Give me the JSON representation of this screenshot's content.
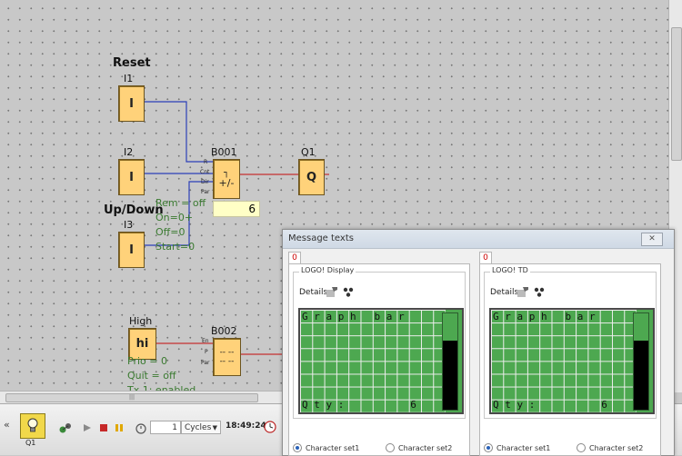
{
  "canvas": {
    "reset_label": "Reset",
    "updown_label": "Up/Down",
    "high_label": "High",
    "blocks": {
      "i1": {
        "name": "I1",
        "symbol": "I"
      },
      "i2": {
        "name": "I2",
        "symbol": "I"
      },
      "i3": {
        "name": "I3",
        "symbol": "I"
      },
      "b001": {
        "name": "B001",
        "symbol": "+/-",
        "pins": [
          "R",
          "Cnt",
          "Dir",
          "Par"
        ],
        "value": "6"
      },
      "q1": {
        "name": "Q1",
        "symbol": "Q"
      },
      "hi": {
        "symbol": "hi"
      },
      "b002": {
        "name": "B002",
        "pins": [
          "En",
          "P",
          "Par"
        ],
        "symbol": "-- --"
      }
    },
    "b001_params": [
      "Rem = off",
      "On=0+",
      "Off=0",
      "Start=0"
    ],
    "b002_params": [
      "Prio = 0",
      "Quit = off",
      "Tx 1: enabled"
    ]
  },
  "message_window": {
    "title": "Message texts",
    "close_label": "✕",
    "panels": [
      {
        "tab": "0",
        "caption": "LOGO! Display",
        "details_label": "Details",
        "lcd_line1": "G r a p h   b a r",
        "lcd_line2": "Q t y :           6",
        "bar_fraction": 0.72,
        "radio1": "Character set1",
        "radio2": "Character set2"
      },
      {
        "tab": "0",
        "caption": "LOGO! TD",
        "details_label": "Details",
        "lcd_line1": "G r a p h   b a r",
        "lcd_line2": "Q t y :           6",
        "bar_fraction": 0.72,
        "radio1": "Character set1",
        "radio2": "Character set2"
      }
    ]
  },
  "sim_toolbar": {
    "collapse": "«",
    "q1_label": "Q1",
    "cycles_value": "1",
    "cycles_unit": "Cycles",
    "time": "18:49:24"
  },
  "scroll": {
    "h_grip": "|||"
  }
}
